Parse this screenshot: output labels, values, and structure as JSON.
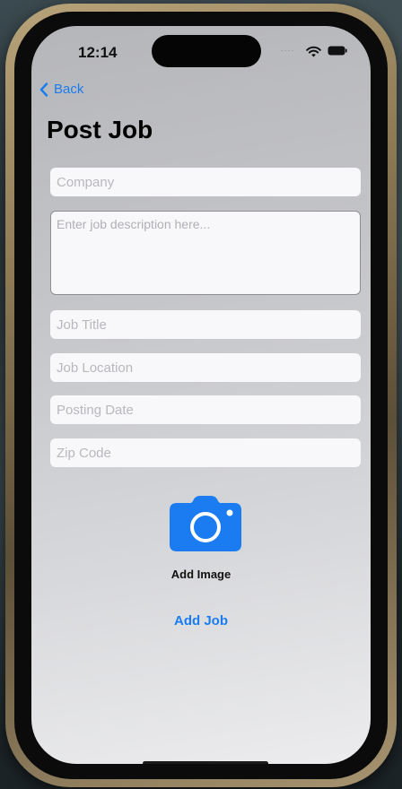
{
  "status_bar": {
    "time": "12:14",
    "signal_dots": "....",
    "wifi_icon": "wifi-icon",
    "battery_icon": "battery-icon"
  },
  "nav": {
    "back_label": "Back",
    "back_icon": "chevron-left-icon"
  },
  "page": {
    "title": "Post Job"
  },
  "form": {
    "company": {
      "value": "",
      "placeholder": "Company"
    },
    "description": {
      "value": "",
      "placeholder": "Enter job description here..."
    },
    "job_title": {
      "value": "",
      "placeholder": "Job Title"
    },
    "job_location": {
      "value": "",
      "placeholder": "Job Location"
    },
    "posting_date": {
      "value": "",
      "placeholder": "Posting Date"
    },
    "zip_code": {
      "value": "",
      "placeholder": "Zip Code"
    }
  },
  "image_picker": {
    "icon": "camera-icon",
    "label": "Add Image"
  },
  "actions": {
    "add_job_label": "Add Job"
  },
  "colors": {
    "accent": "#1a7cf0",
    "field_background": "#f8f8fa",
    "screen_background": "#c4c5c9"
  }
}
